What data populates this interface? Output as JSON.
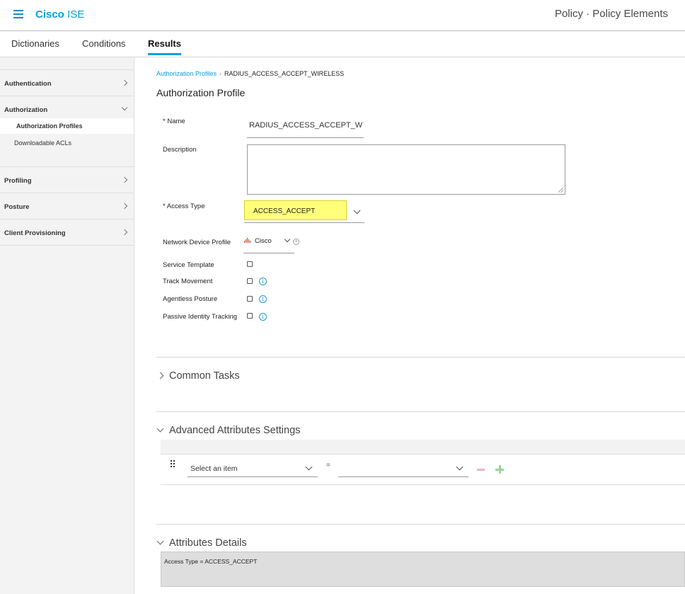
{
  "header": {
    "brand_bold": "Cisco",
    "brand_rest": "ISE",
    "page_title": "Policy · Policy Elements",
    "accent_color": "#049fd9"
  },
  "tabs": [
    {
      "label": "Dictionaries",
      "active": false
    },
    {
      "label": "Conditions",
      "active": false
    },
    {
      "label": "Results",
      "active": true
    }
  ],
  "sidebar": {
    "sections": [
      {
        "label": "Authentication",
        "expanded": false
      },
      {
        "label": "Authorization",
        "expanded": true,
        "items": [
          {
            "label": "Authorization Profiles",
            "active": true
          },
          {
            "label": "Downloadable ACLs",
            "active": false
          }
        ]
      },
      {
        "label": "Profiling",
        "expanded": false
      },
      {
        "label": "Posture",
        "expanded": false
      },
      {
        "label": "Client Provisioning",
        "expanded": false
      }
    ]
  },
  "breadcrumb": {
    "parent": "Authorization Profiles",
    "current": "RADIUS_ACCESS_ACCEPT_WIRELESS"
  },
  "form": {
    "title": "Authorization Profile",
    "name_label": "* Name",
    "name_value": "RADIUS_ACCESS_ACCEPT_W",
    "description_label": "Description",
    "description_value": "",
    "access_type_label": "* Access Type",
    "access_type_value": "ACCESS_ACCEPT",
    "ndp_label": "Network Device Profile",
    "ndp_value": "Cisco",
    "checkboxes": [
      {
        "label": "Service Template",
        "checked": false,
        "info": false
      },
      {
        "label": "Track Movement",
        "checked": false,
        "info": true
      },
      {
        "label": "Agentless Posture",
        "checked": false,
        "info": true
      },
      {
        "label": "Passive Identity Tracking",
        "checked": false,
        "info": true
      }
    ]
  },
  "sections": {
    "common_tasks": "Common Tasks",
    "advanced": "Advanced Attributes Settings",
    "details": "Attributes Details"
  },
  "advanced_row": {
    "attribute_placeholder": "Select an item",
    "operator": "=",
    "value": ""
  },
  "details": {
    "text": "Access Type = ACCESS_ACCEPT"
  }
}
